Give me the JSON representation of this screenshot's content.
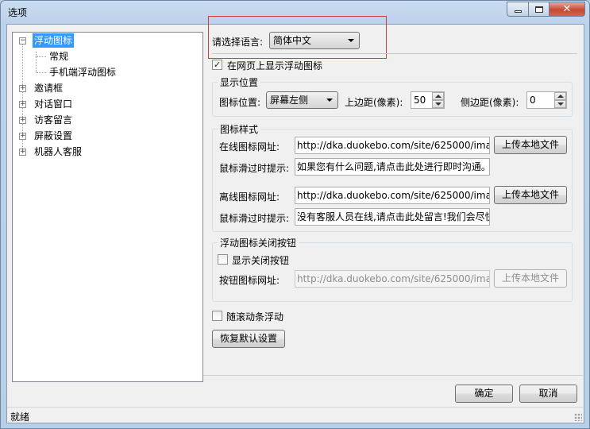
{
  "window": {
    "title": "选项",
    "minimize_icon": "minimize-icon",
    "maximize_icon": "maximize-icon",
    "close_icon": "close-icon"
  },
  "tree": {
    "items": [
      {
        "label": "浮动图标",
        "expander": "⊟",
        "selected": true
      },
      {
        "label": "常规"
      },
      {
        "label": "手机端浮动图标"
      },
      {
        "label": "邀请框",
        "expander": "⊞"
      },
      {
        "label": "对话窗口",
        "expander": "⊞"
      },
      {
        "label": "访客留言",
        "expander": "⊞"
      },
      {
        "label": "屏蔽设置",
        "expander": "⊞"
      },
      {
        "label": "机器人客服",
        "expander": "⊞"
      }
    ]
  },
  "language": {
    "label": "请选择语言:",
    "selected": "简体中文"
  },
  "show_float_icon": {
    "label": "在网页上显示浮动图标",
    "checked": true,
    "mark": "✓"
  },
  "position_group": {
    "title": "显示位置",
    "icon_position_label": "图标位置:",
    "icon_position_value": "屏幕左侧",
    "top_margin_label": "上边距(像素):",
    "top_margin_value": "50",
    "side_margin_label": "侧边距(像素):",
    "side_margin_value": "0"
  },
  "style_group": {
    "title": "图标样式",
    "online_url_label": "在线图标网址:",
    "online_url_value": "http://dka.duokebo.com/site/625000/ima",
    "online_upload": "上传本地文件",
    "online_hover_label": "鼠标滑过时提示:",
    "online_hover_value": "如果您有什么问题,请点击此处进行即时沟通。",
    "offline_url_label": "离线图标网址:",
    "offline_url_value": "http://dka.duokebo.com/site/625000/ima",
    "offline_upload": "上传本地文件",
    "offline_hover_label": "鼠标滑过时提示:",
    "offline_hover_value": "没有客服人员在线,请点击此处留言!我们会尽快"
  },
  "close_group": {
    "title": "浮动图标关闭按钮",
    "show_close_label": "显示关闭按钮",
    "button_url_label": "按钮图标网址:",
    "button_url_value": "http://dka.duokebo.com/site/625000/ima",
    "upload": "上传本地文件"
  },
  "scroll_float": {
    "label": "随滚动条浮动",
    "checked": false
  },
  "restore_defaults": "恢复默认设置",
  "ok": "确定",
  "cancel": "取消",
  "status": "就绪"
}
